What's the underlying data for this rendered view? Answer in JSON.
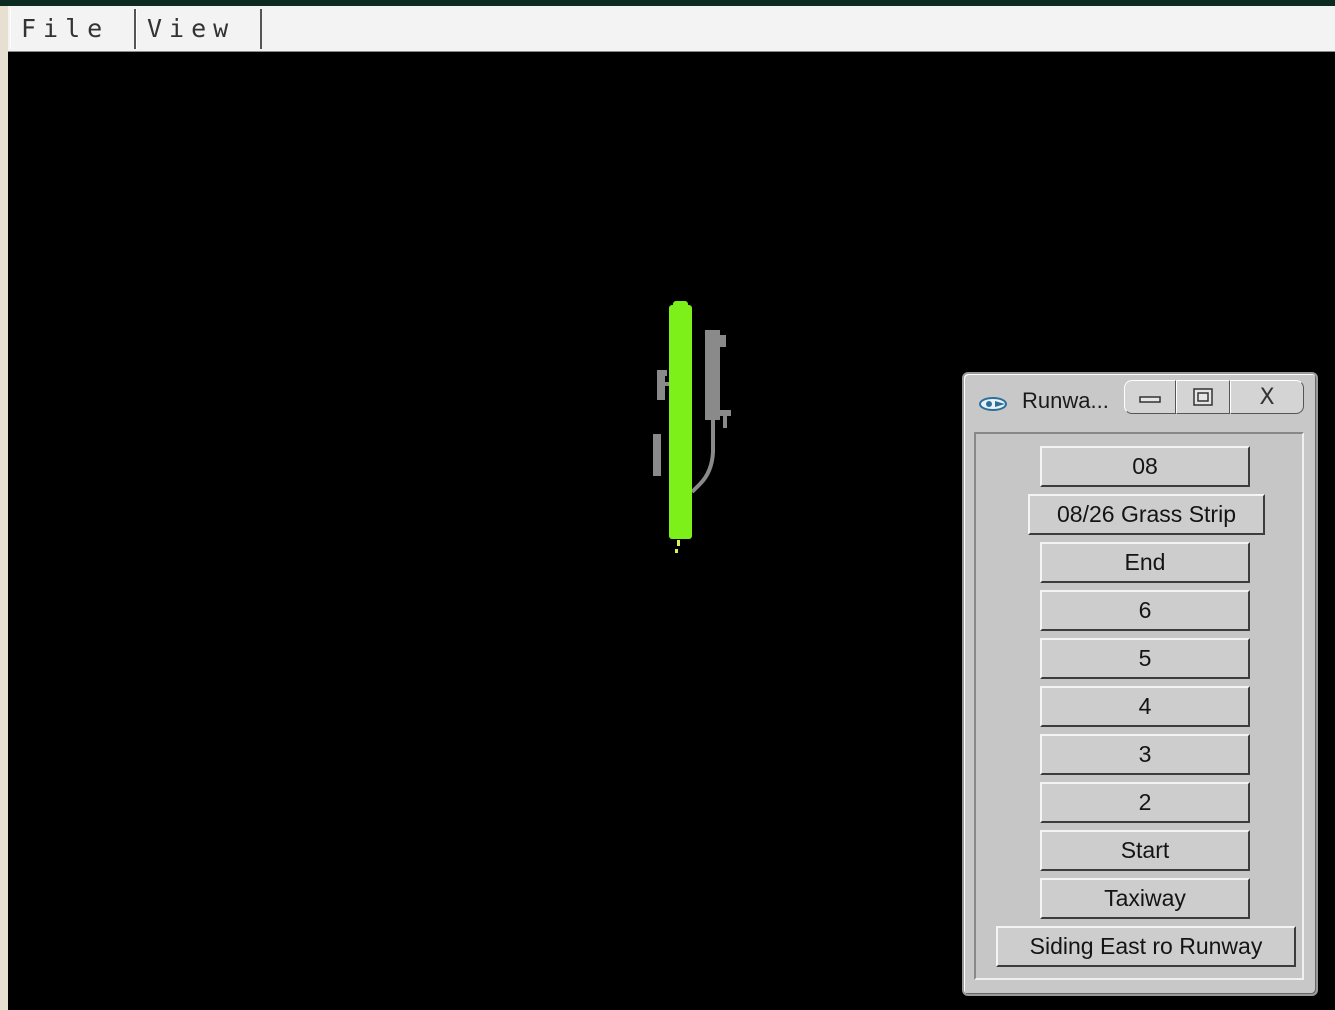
{
  "menubar": {
    "file_label": "File",
    "view_label": "View"
  },
  "map": {
    "runway_color": "#7df01a",
    "taxiway_color": "#8a8a8a",
    "background_color": "#000000"
  },
  "runway_window": {
    "title": "Runwa...",
    "close_glyph": "X",
    "buttons": [
      "08",
      "08/26 Grass Strip",
      "End",
      "6",
      "5",
      "4",
      "3",
      "2",
      "Start",
      "Taxiway",
      "Siding East ro Runway"
    ]
  }
}
